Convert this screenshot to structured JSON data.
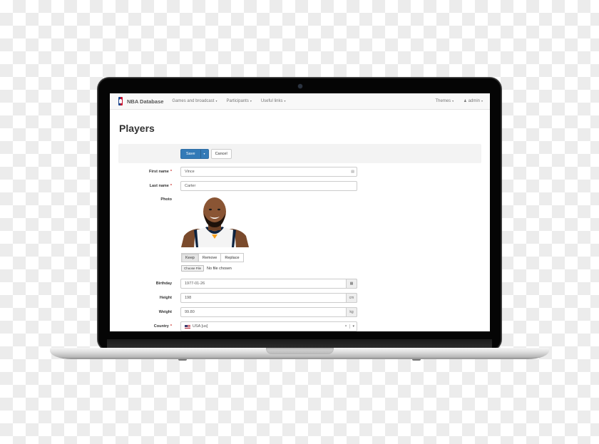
{
  "navbar": {
    "brand": "NBA Database",
    "menu": [
      {
        "label": "Games and broadcast"
      },
      {
        "label": "Participants"
      },
      {
        "label": "Useful links"
      }
    ],
    "right": [
      {
        "label": "Themes"
      },
      {
        "label": "admin"
      }
    ],
    "caret": "▾"
  },
  "page": {
    "title": "Players"
  },
  "toolbar": {
    "save_label": "Save",
    "cancel_label": "Cancel"
  },
  "form": {
    "required_mark": "*",
    "first_name": {
      "label": "First name",
      "value": "Vince"
    },
    "last_name": {
      "label": "Last name",
      "value": "Carter"
    },
    "photo": {
      "label": "Photo",
      "buttons": [
        "Keep",
        "Remove",
        "Replace"
      ],
      "active_button": "Keep",
      "choose_file_label": "Choose File",
      "file_status": "No file chosen"
    },
    "birthday": {
      "label": "Birthday",
      "value": "1977-01-26",
      "icon": "calendar-icon"
    },
    "height": {
      "label": "Height",
      "value": "198",
      "unit": "cm"
    },
    "weight": {
      "label": "Weight",
      "value": "99.80",
      "unit": "kg"
    },
    "country": {
      "label": "Country",
      "value": "USA [us]",
      "clear": "×",
      "caret": "▾"
    }
  }
}
